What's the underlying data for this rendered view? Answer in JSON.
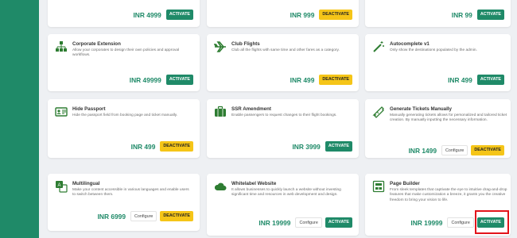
{
  "cards": [
    {
      "title": "",
      "desc": "",
      "price": "INR 4999",
      "buttons": [
        "ACTIVATE"
      ]
    },
    {
      "title": "",
      "desc": "",
      "price": "INR 999",
      "buttons": [
        "DEACTIVATE"
      ]
    },
    {
      "title": "",
      "desc": "",
      "price": "INR 99",
      "buttons": [
        "ACTIVATE"
      ]
    },
    {
      "title": "Corporate Extension",
      "desc": "Allow your corporates to design their own policies and approval workflows.",
      "price": "INR 49999",
      "buttons": [
        "ACTIVATE"
      ],
      "icon": "org-chart-icon"
    },
    {
      "title": "Club Flights",
      "desc": "Club all the flights with same time and other fares as a category.",
      "price": "INR 499",
      "buttons": [
        "DEACTIVATE"
      ],
      "icon": "plane-icon"
    },
    {
      "title": "Autocomplete v1",
      "desc": "Only show the destinations populated by the admin.",
      "price": "INR 499",
      "buttons": [
        "ACTIVATE"
      ],
      "icon": "magic-wand-icon"
    },
    {
      "title": "Hide Passport",
      "desc": "Hide the passport field from booking page and ticket manually.",
      "price": "INR 499",
      "buttons": [
        "DEACTIVATE"
      ],
      "icon": "id-card-icon"
    },
    {
      "title": "SSR Amendment",
      "desc": "Enable passengers to request changes to their flight bookings.",
      "price": "INR 3999",
      "buttons": [
        "ACTIVATE"
      ],
      "icon": "luggage-icon"
    },
    {
      "title": "Generate Tickets Manually",
      "desc": "Manually generating tickets allows for personalized and tailored ticket creation. By manually inputting the necessary information.",
      "price": "INR 1499",
      "buttons": [
        "Configure",
        "DEACTIVATE"
      ],
      "icon": "ticket-icon"
    },
    {
      "title": "Multilingual",
      "desc": "Make your content accessible in various languages and enable users to switch between them.",
      "price": "INR 6999",
      "buttons": [
        "Configure",
        "DEACTIVATE"
      ],
      "icon": "translate-icon"
    },
    {
      "title": "Whitelabel Website",
      "desc": "It allows businesses to quickly launch a website without investing significant time and resources in web development and design.",
      "price": "INR 19999",
      "buttons": [
        "Configure",
        "ACTIVATE"
      ],
      "icon": "cloud-icon"
    },
    {
      "title": "Page Builder",
      "desc": "From sleek templates that captivate the eye to intuitive drag-and-drop features that make customization a breeze, it grants you the creative freedom to bring your vision to life.",
      "price": "INR 19999",
      "buttons": [
        "Configure",
        "ACTIVATE"
      ],
      "icon": "page-builder-icon"
    }
  ],
  "colors": {
    "brand": "#1f8a68",
    "deactivate": "#f5c518",
    "highlight": "#e2141b"
  }
}
